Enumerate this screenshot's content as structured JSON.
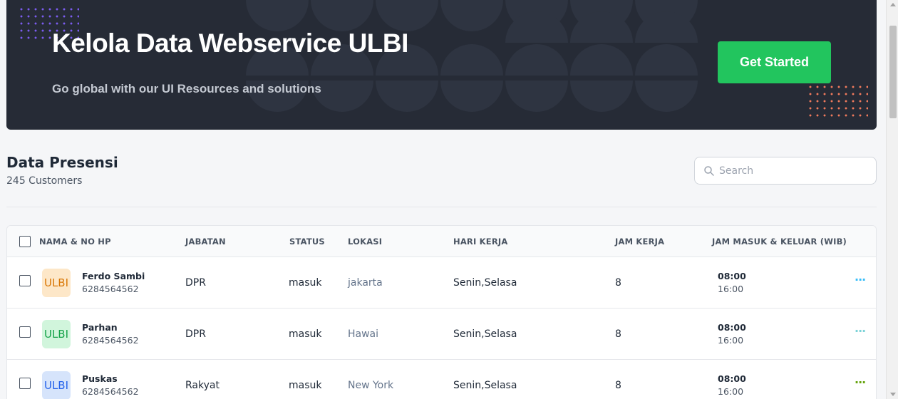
{
  "hero": {
    "title": "Kelola Data Webservice ULBI",
    "subtitle": "Go global with our UI Resources and solutions",
    "cta_label": "Get Started"
  },
  "section": {
    "title": "Data Presensi",
    "subtitle": "245 Customers"
  },
  "search": {
    "placeholder": "Search"
  },
  "table": {
    "headers": [
      "NAMA & NO HP",
      "JABATAN",
      "STATUS",
      "LOKASI",
      "HARI KERJA",
      "JAM KERJA",
      "JAM MASUK & KELUAR (WIB)"
    ],
    "rows": [
      {
        "avatar": "ULBI",
        "avatar_color": "#d97706",
        "avatar_bg": "#fde7c8",
        "name": "Ferdo Sambi",
        "phone": "6284564562",
        "jabatan": "DPR",
        "status": "masuk",
        "lokasi": "jakarta",
        "hari": "Senin,Selasa",
        "jam": "8",
        "masuk": "08:00",
        "keluar": "16:00",
        "more_color": "#38bdf8"
      },
      {
        "avatar": "ULBI",
        "avatar_color": "#16a34a",
        "avatar_bg": "#d1f5dc",
        "name": "Parhan",
        "phone": "6284564562",
        "jabatan": "DPR",
        "status": "masuk",
        "lokasi": "Hawai",
        "hari": "Senin,Selasa",
        "jam": "8",
        "masuk": "08:00",
        "keluar": "16:00",
        "more_color": "#7dd3d8"
      },
      {
        "avatar": "ULBI",
        "avatar_color": "#2563eb",
        "avatar_bg": "#d6e4fb",
        "name": "Puskas",
        "phone": "6284564562",
        "jabatan": "Rakyat",
        "status": "masuk",
        "lokasi": "New York",
        "hari": "Senin,Selasa",
        "jam": "8",
        "masuk": "08:00",
        "keluar": "16:00",
        "more_color": "#65a30d"
      }
    ]
  },
  "icons": [
    "search-icon",
    "more-icon"
  ]
}
